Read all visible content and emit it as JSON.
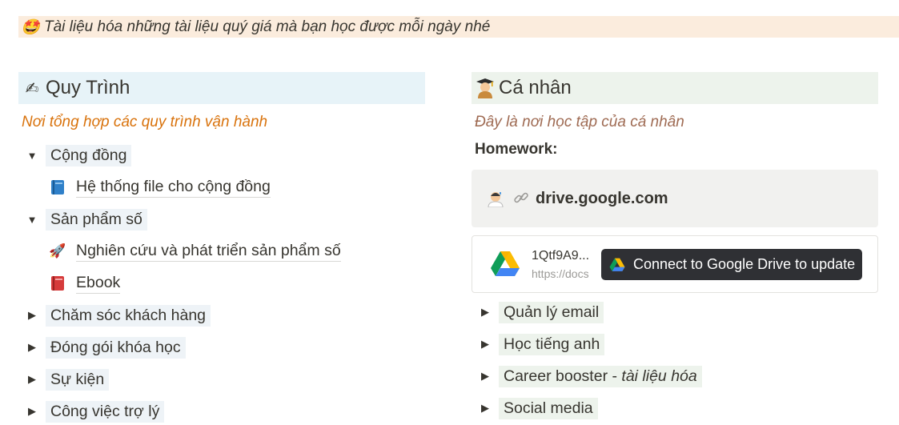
{
  "callout": {
    "icon": "star-struck-emoji",
    "emoji": "🤩",
    "text": "Tài liệu hóa những tài liệu quý giá mà bạn học được mỗi ngày nhé"
  },
  "left": {
    "heading_emoji": "✍",
    "heading": "Quy Trình",
    "subtitle": "Nơi tổng hợp các quy trình vận hành",
    "tree": [
      {
        "type": "toggle",
        "state": "open",
        "label": "Cộng đồng"
      },
      {
        "type": "page",
        "icon": "blue-book-icon",
        "label": "Hệ thống file cho cộng đồng"
      },
      {
        "type": "toggle",
        "state": "open",
        "label": "Sản phẩm số"
      },
      {
        "type": "page",
        "icon": "rocket-icon",
        "emoji": "🚀",
        "label": "Nghiên cứu và phát triển sản phẩm số"
      },
      {
        "type": "page",
        "icon": "red-book-icon",
        "label": "Ebook"
      },
      {
        "type": "toggle",
        "state": "closed",
        "label": "Chăm sóc khách hàng"
      },
      {
        "type": "toggle",
        "state": "closed",
        "label": "Đóng gói khóa học"
      },
      {
        "type": "toggle",
        "state": "closed",
        "label": "Sự kiện"
      },
      {
        "type": "toggle",
        "state": "closed",
        "label": "Công việc trợ lý"
      }
    ]
  },
  "right": {
    "heading_emoji": "👨‍🎓",
    "heading": "Cá nhân",
    "subtitle": "Đây là nơi học tập của cá nhân",
    "homework_label": "Homework:",
    "bookmark": {
      "icon": "scientist-emoji",
      "link_icon": "link-icon",
      "text": "drive.google.com"
    },
    "embed": {
      "title": "1Qtf9A9...",
      "url": "https://docs",
      "connect_label": "Connect to Google Drive to update"
    },
    "tree": [
      {
        "type": "toggle",
        "state": "closed",
        "label": "Quản lý email"
      },
      {
        "type": "toggle",
        "state": "closed",
        "label": "Học tiếng anh"
      },
      {
        "type": "toggle",
        "state": "closed",
        "label_main": "Career booster - ",
        "label_italic": "tài liệu hóa"
      },
      {
        "type": "toggle",
        "state": "closed",
        "label": "Social media"
      }
    ]
  },
  "colors": {
    "callout_bg": "#fbecdd",
    "heading_blue_bg": "#e7f3f8",
    "heading_green_bg": "#edf3ec",
    "subtitle_orange": "#d9730d",
    "subtitle_brown": "#9f6b53",
    "tooltip_bg": "#2f3034"
  }
}
